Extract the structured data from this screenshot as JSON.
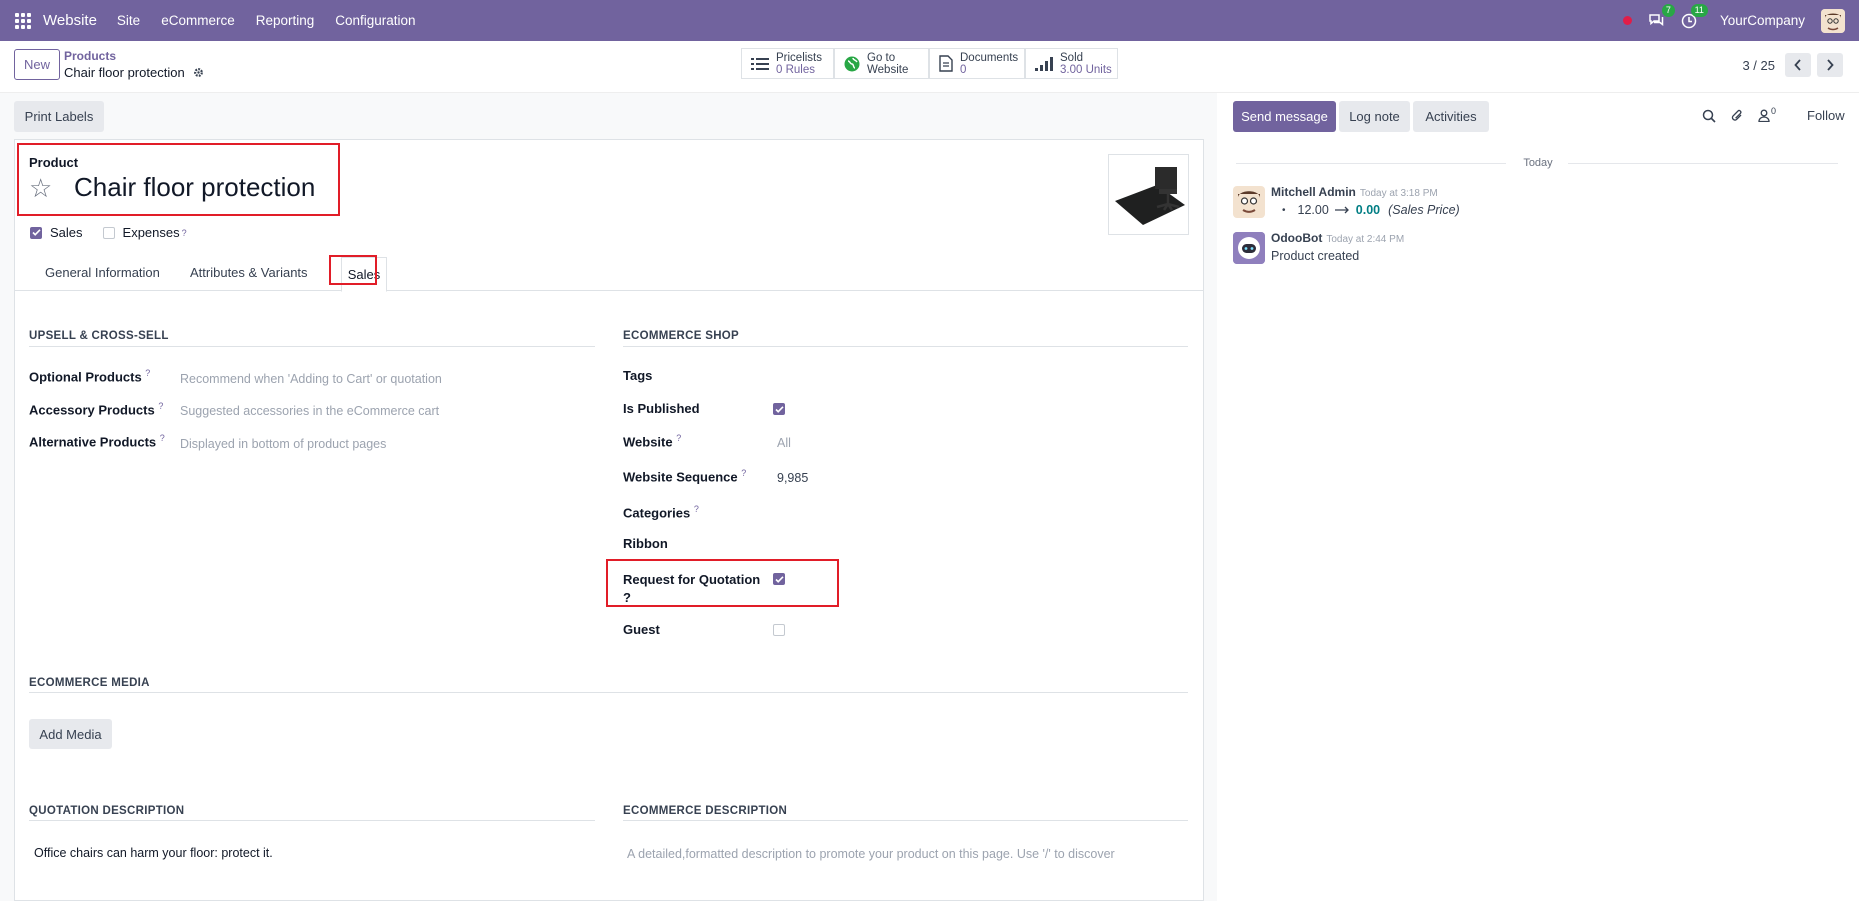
{
  "topbar": {
    "app_name": "Website",
    "menu": [
      "Site",
      "eCommerce",
      "Reporting",
      "Configuration"
    ],
    "chat_count": "7",
    "activity_count": "11",
    "company": "YourCompany"
  },
  "control": {
    "new_label": "New",
    "breadcrumb_parent": "Products",
    "breadcrumb_current": "Chair floor protection",
    "smart_buttons": [
      {
        "line1": "Pricelists",
        "line2": "0  Rules",
        "icon": "list-icon"
      },
      {
        "line1": "Go to",
        "line2": "Website",
        "icon": "globe-icon"
      },
      {
        "line1": "Documents",
        "line2": "0",
        "icon": "document-icon"
      },
      {
        "line1": "Sold",
        "line2": "3.00 Units",
        "icon": "bar-chart-icon"
      }
    ],
    "pager": "3 / 25"
  },
  "form": {
    "print_labels": "Print Labels",
    "product_label": "Product",
    "product_name": "Chair floor protection",
    "sales_label": "Sales",
    "expenses_label": "Expenses",
    "tabs": [
      "General Information",
      "Attributes & Variants",
      "Sales"
    ],
    "upsell": {
      "title": "UPSELL & CROSS-SELL",
      "fields": [
        {
          "label": "Optional Products",
          "placeholder": "Recommend when 'Adding to Cart' or quotation"
        },
        {
          "label": "Accessory Products",
          "placeholder": "Suggested accessories in the eCommerce cart"
        },
        {
          "label": "Alternative Products",
          "placeholder": "Displayed in bottom of product pages"
        }
      ]
    },
    "shop": {
      "title": "ECOMMERCE SHOP",
      "tags": "Tags",
      "is_published": "Is Published",
      "website": "Website",
      "website_value": "All",
      "sequence": "Website Sequence",
      "sequence_value": "9,985",
      "categories": "Categories",
      "ribbon": "Ribbon",
      "rfq_line1": "Request for Quotation",
      "rfq_line2": "?",
      "guest": "Guest"
    },
    "media": {
      "title": "ECOMMERCE MEDIA",
      "add": "Add Media"
    },
    "quotation": {
      "title": "QUOTATION DESCRIPTION",
      "text": "Office chairs can harm your floor: protect it."
    },
    "ecom_desc": {
      "title": "ECOMMERCE DESCRIPTION",
      "placeholder": "A detailed,formatted description to promote your product on this page. Use '/' to discover"
    }
  },
  "chatter": {
    "send": "Send message",
    "log": "Log note",
    "activities": "Activities",
    "followers": "0",
    "follow": "Follow",
    "today": "Today",
    "messages": [
      {
        "author": "Mitchell Admin",
        "time": "Today at 3:18 PM",
        "old": "12.00",
        "new": "0.00",
        "field": "(Sales Price)"
      },
      {
        "author": "OdooBot",
        "time": "Today at 2:44 PM",
        "text": "Product created"
      }
    ]
  }
}
